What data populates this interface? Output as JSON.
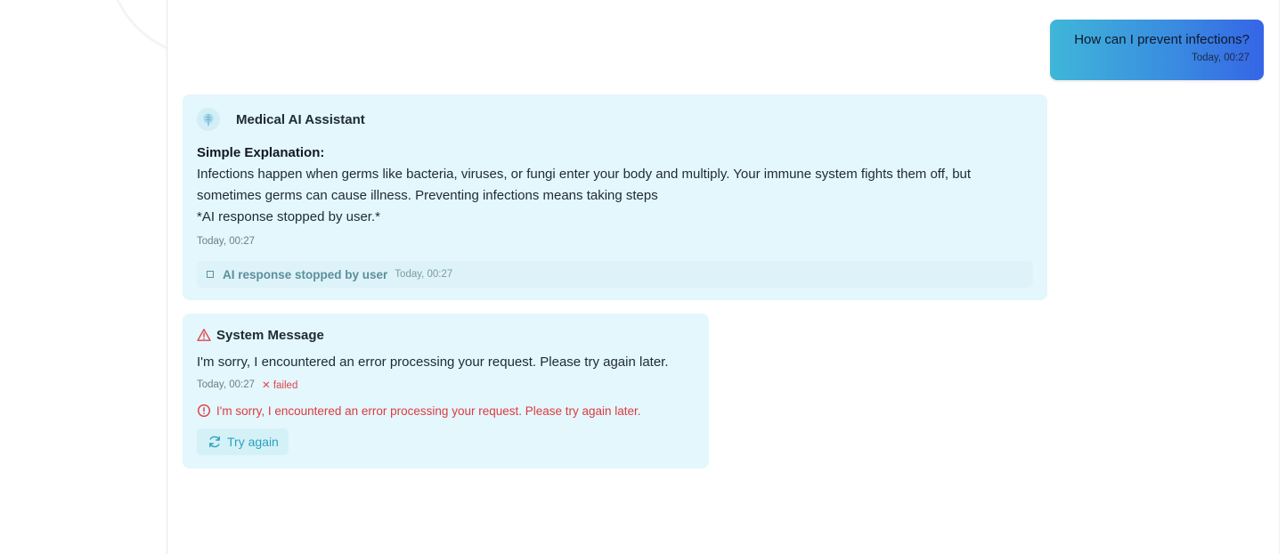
{
  "user_message": {
    "text": "How can I prevent infections?",
    "time": "Today, 00:27"
  },
  "ai_message": {
    "sender": "Medical AI Assistant",
    "avatar_icon": "brain-icon",
    "heading": "Simple Explanation:",
    "body_line1": "Infections happen when germs like bacteria, viruses, or fungi enter your body and multiply. Your immune system fights them off, but",
    "body_line2": "sometimes germs can cause illness. Preventing infections means taking steps",
    "body_line3": "*AI response stopped by user.*",
    "time": "Today, 00:27",
    "stopped_label": "AI response stopped by user",
    "stopped_time": "Today, 00:27"
  },
  "system_message": {
    "title": "System Message",
    "body": "I'm sorry, I encountered an error processing your request. Please try again later.",
    "time": "Today, 00:27",
    "status": "✕ failed",
    "error_text": "I'm sorry, I encountered an error processing your request. Please try again later.",
    "retry_label": "Try again"
  },
  "colors": {
    "card_bg": "#e3f7fc",
    "error": "#dc3b41",
    "accent": "#2aa3bd",
    "user_gradient_start": "#3fb6d8",
    "user_gradient_end": "#3565e6"
  }
}
